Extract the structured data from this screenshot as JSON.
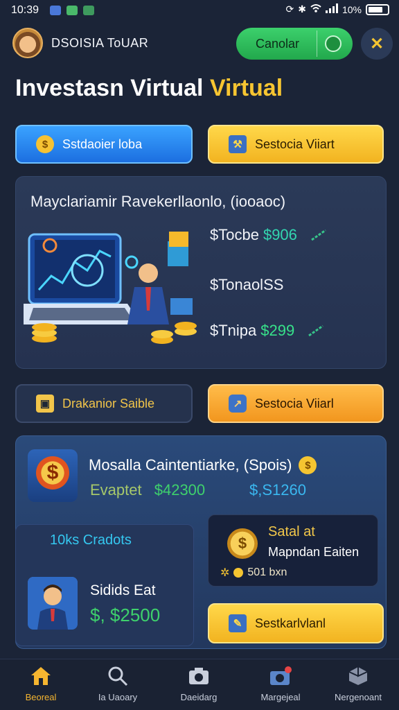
{
  "status_bar": {
    "time": "10:39",
    "battery": "10%"
  },
  "header": {
    "app_title": "DSOISIA ToUAR",
    "cancel_label": "Canolar"
  },
  "page_title": {
    "main": "Investasn Virtual",
    "highlight": "Virtual"
  },
  "actions_top": {
    "blue_label": "Sstdaoier loba",
    "yellow_label": "Sestocia Viiart"
  },
  "overview": {
    "title": "Mayclariamir Ravekerllaonlo, (iooaoc)",
    "stats": [
      {
        "label": "$Tocbe",
        "value": "$906"
      },
      {
        "label": "$TonaolSS",
        "value": ""
      },
      {
        "label": "$Tnipa",
        "value": "$299"
      }
    ]
  },
  "actions_mid": {
    "dark_label": "Drakanior Saible",
    "orange_label": "Sestocia Viiarl"
  },
  "portfolio": {
    "title": "Mosalla Caintentiarke, (Spois)",
    "stat1_label": "Evaptet",
    "stat1_value": "$42300",
    "stat2_value": "$,S1260",
    "sub_card": {
      "title": "10ks Cradots",
      "label": "Sidids Eat",
      "value": "$, $2500"
    },
    "right_card": {
      "title": "Satal at",
      "subtitle": "Mapndan Eaiten",
      "meta": "501 bxn"
    },
    "button_label": "Sestkarlvlanl"
  },
  "bottom_nav": [
    {
      "label": "Beoreal",
      "icon": "home-icon",
      "active": true
    },
    {
      "label": "Ia Uaoary",
      "icon": "search-icon",
      "active": false
    },
    {
      "label": "Daeidarg",
      "icon": "camera-icon",
      "active": false
    },
    {
      "label": "Margejeal",
      "icon": "camera-notify-icon",
      "active": false
    },
    {
      "label": "Nergenoant",
      "icon": "cube-icon",
      "active": false
    }
  ],
  "colors": {
    "background": "#1b2437",
    "accent_yellow": "#f7c531",
    "accent_green": "#37e28a",
    "accent_blue": "#1c6fe0",
    "nav_active": "#f5b530"
  }
}
